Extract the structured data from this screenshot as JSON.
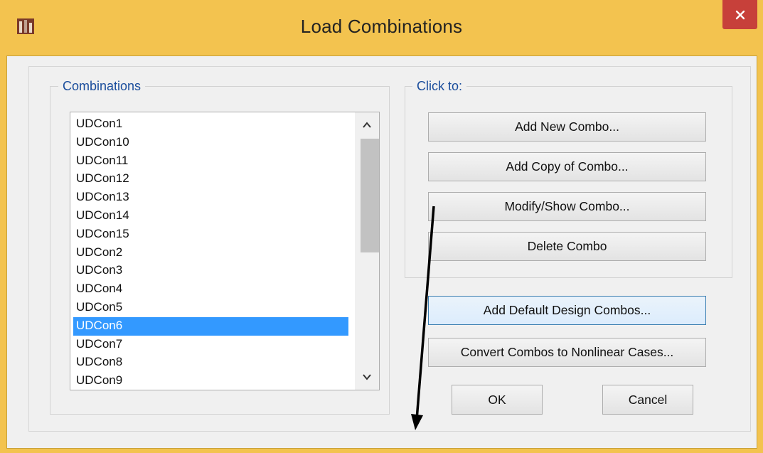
{
  "window": {
    "title": "Load Combinations"
  },
  "combinations": {
    "label": "Combinations",
    "items": [
      "UDCon1",
      "UDCon10",
      "UDCon11",
      "UDCon12",
      "UDCon13",
      "UDCon14",
      "UDCon15",
      "UDCon2",
      "UDCon3",
      "UDCon4",
      "UDCon5",
      "UDCon6",
      "UDCon7",
      "UDCon8",
      "UDCon9"
    ],
    "selected": "UDCon6"
  },
  "click_to": {
    "label": "Click to:",
    "add_new": "Add New Combo...",
    "add_copy": "Add Copy of Combo...",
    "modify": "Modify/Show Combo...",
    "delete": "Delete Combo"
  },
  "buttons": {
    "add_default": "Add Default Design Combos...",
    "convert": "Convert Combos to Nonlinear Cases...",
    "ok": "OK",
    "cancel": "Cancel"
  },
  "colors": {
    "titlebar": "#f3c34f",
    "selection": "#3399ff",
    "close": "#c7403a"
  }
}
